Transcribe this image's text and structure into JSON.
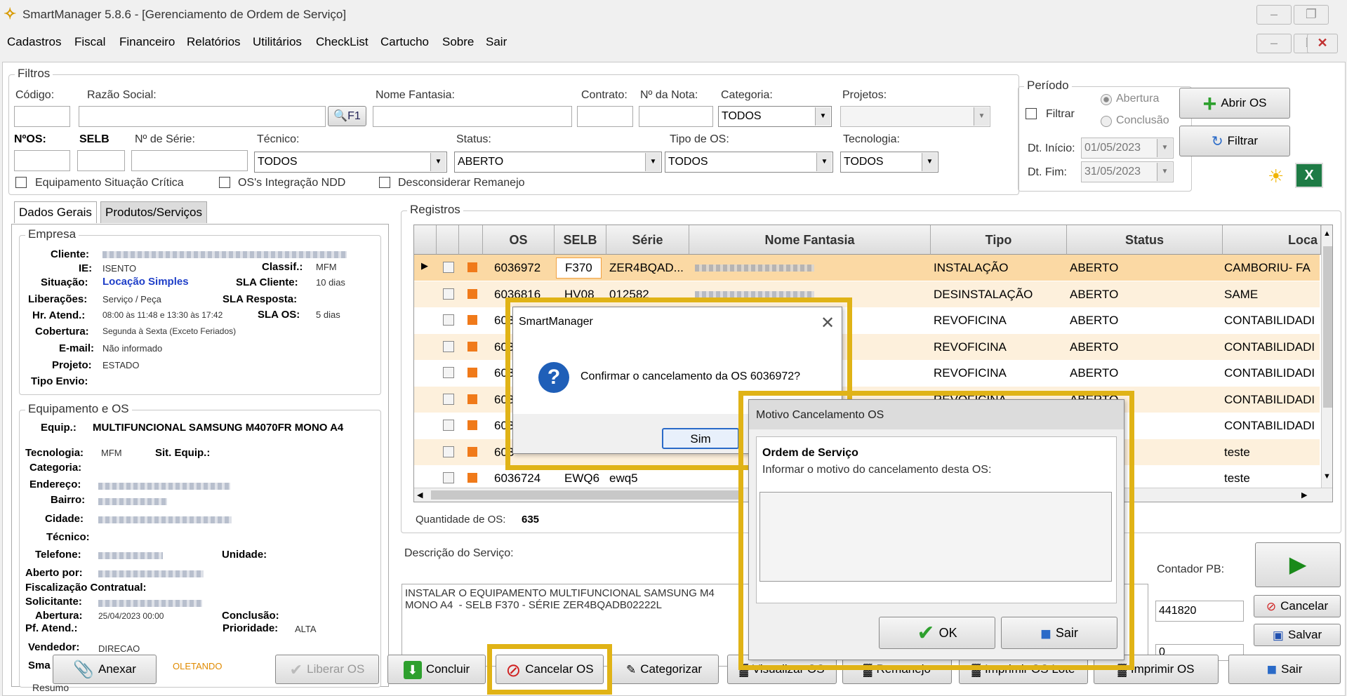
{
  "window": {
    "title": "SmartManager 5.8.6 - [Gerenciamento de Ordem de Serviço]"
  },
  "menu": [
    "Cadastros",
    "Fiscal",
    "Financeiro",
    "Relatórios",
    "Utilitários",
    "CheckList",
    "Cartucho",
    "Sobre",
    "Sair"
  ],
  "filters": {
    "group_label": "Filtros",
    "codigo_label": "Código:",
    "razao_label": "Razão Social:",
    "f1_button": "F1",
    "nome_fantasia_label": "Nome Fantasia:",
    "contrato_label": "Contrato:",
    "nota_label": "Nº da Nota:",
    "categoria_label": "Categoria:",
    "categoria_value": "TODOS",
    "projetos_label": "Projetos:",
    "nos_label": "NºOS:",
    "selb_label": "SELB",
    "serie_label": "Nº de Série:",
    "tecnico_label": "Técnico:",
    "tecnico_value": "TODOS",
    "status_label": "Status:",
    "status_value": "ABERTO",
    "tipo_os_label": "Tipo de OS:",
    "tipo_os_value": "TODOS",
    "tecnologia_label": "Tecnologia:",
    "tecnologia_value": "TODOS",
    "chk_critica": "Equipamento Situação Crítica",
    "chk_ndd": "OS's Integração NDD",
    "chk_remanejo": "Desconsiderar Remanejo"
  },
  "periodo": {
    "group_label": "Período",
    "filtrar_label": "Filtrar",
    "abertura": "Abertura",
    "conclusao": "Conclusão",
    "dt_inicio_label": "Dt. Início:",
    "dt_inicio": "01/05/2023",
    "dt_fim_label": "Dt. Fim:",
    "dt_fim": "31/05/2023"
  },
  "buttons": {
    "abrir_os": "Abrir OS",
    "filtrar": "Filtrar"
  },
  "tabs": [
    "Dados Gerais",
    "Produtos/Serviços"
  ],
  "empresa": {
    "group_label": "Empresa",
    "cliente_label": "Cliente:",
    "ie_label": "IE:",
    "ie": "ISENTO",
    "classif_label": "Classif.:",
    "classif": "MFM",
    "situacao_label": "Situação:",
    "situacao": "Locação Simples",
    "sla_cliente_label": "SLA Cliente:",
    "sla_cliente": "10 dias",
    "liberacoes_label": "Liberações:",
    "liberacoes": "Serviço / Peça",
    "sla_resposta_label": "SLA Resposta:",
    "hr_atend_label": "Hr. Atend.:",
    "hr_atend": "08:00 às 11:48 e 13:30 às 17:42",
    "sla_os_label": "SLA OS:",
    "sla_os": "5 dias",
    "cobertura_label": "Cobertura:",
    "cobertura": "Segunda à Sexta (Exceto Feriados)",
    "email_label": "E-mail:",
    "email": "Não informado",
    "projeto_label": "Projeto:",
    "projeto": "ESTADO",
    "tipo_envio_label": "Tipo Envio:"
  },
  "equipamento": {
    "group_label": "Equipamento e OS",
    "equip_label": "Equip.:",
    "equip": "MULTIFUNCIONAL SAMSUNG M4070FR MONO A4",
    "tecnologia_label": "Tecnologia:",
    "tecnologia": "MFM",
    "sit_equip_label": "Sit. Equip.:",
    "categoria_label": "Categoria:",
    "endereco_label": "Endereço:",
    "bairro_label": "Bairro:",
    "cidade_label": "Cidade:",
    "tecnico_label": "Técnico:",
    "telefone_label": "Telefone:",
    "unidade_label": "Unidade:",
    "aberto_por_label": "Aberto por:",
    "fiscalizacao_label": "Fiscalização Contratual:",
    "solicitante_label": "Solicitante:",
    "abertura_label": "Abertura:",
    "abertura": "25/04/2023 00:00",
    "conclusao_label": "Conclusão:",
    "pf_atend_label": "Pf. Atend.:",
    "prioridade_label": "Prioridade:",
    "prioridade": "ALTA",
    "vendedor_label": "Vendedor:",
    "vendedor": "DIRECAO",
    "sma_label": "Sma",
    "sma_value": "OLETANDO",
    "resumo_label": "Resumo"
  },
  "registros": {
    "group_label": "Registros",
    "columns": [
      "OS",
      "SELB",
      "Série",
      "Nome Fantasia",
      "Tipo",
      "Status",
      "Loca"
    ],
    "rows": [
      {
        "os": "6036972",
        "selb": "F370",
        "serie": "ZER4BQAD...",
        "tipo": "INSTALAÇÃO",
        "status": "ABERTO",
        "local": "CAMBORIU- FA"
      },
      {
        "os": "6036816",
        "selb": "HV08",
        "serie": "012582",
        "tipo": "DESINSTALAÇÃO",
        "status": "ABERTO",
        "local": "SAME"
      },
      {
        "os": "603",
        "selb": "",
        "serie": "",
        "tipo": "REVOFICINA",
        "status": "ABERTO",
        "local": "CONTABILIDADI"
      },
      {
        "os": "603",
        "selb": "",
        "serie": "",
        "tipo": "REVOFICINA",
        "status": "ABERTO",
        "local": "CONTABILIDADI"
      },
      {
        "os": "603",
        "selb": "",
        "serie": "",
        "tipo": "REVOFICINA",
        "status": "ABERTO",
        "local": "CONTABILIDADI"
      },
      {
        "os": "603",
        "selb": "",
        "serie": "",
        "tipo": "REVOFICINA",
        "status": "ABERTO",
        "local": "CONTABILIDADI"
      },
      {
        "os": "603",
        "selb": "",
        "serie": "",
        "tipo": "",
        "status": "",
        "local": "CONTABILIDADI"
      },
      {
        "os": "603",
        "selb": "",
        "serie": "",
        "tipo": "",
        "status": "",
        "local": "teste"
      },
      {
        "os": "6036724",
        "selb": "EWQ6",
        "serie": "ewq5",
        "tipo": "",
        "status": "",
        "local": "teste"
      }
    ],
    "qty_label": "Quantidade de OS:",
    "qty": "635"
  },
  "descricao": {
    "label": "Descrição do Serviço:",
    "text": "INSTALAR O EQUIPAMENTO MULTIFUNCIONAL SAMSUNG M4\nMONO A4  - SELB F370 - SÉRIE ZER4BQADB02222L"
  },
  "contador": {
    "label": "Contador PB:",
    "value": "441820",
    "value2": "0"
  },
  "side_buttons": {
    "cancelar": "Cancelar",
    "salvar": "Salvar"
  },
  "bottom_buttons": {
    "anexar": "Anexar",
    "liberar_os": "Liberar OS",
    "concluir": "Concluir",
    "cancelar_os": "Cancelar OS",
    "categorizar": "Categorizar",
    "visualizar_os": "Visualizar OS",
    "remanejo": "Remanejo",
    "imprimir_os_lote": "Imprimir OS Lote",
    "imprimir_os": "Imprimir OS",
    "sair": "Sair"
  },
  "confirm_dialog": {
    "title": "SmartManager",
    "message": "Confirmar o cancelamento da OS 6036972?",
    "sim": "Sim"
  },
  "motivo_dialog": {
    "title": "Motivo Cancelamento OS",
    "group": "Ordem de Serviço",
    "prompt": "Informar o motivo do cancelamento desta OS:",
    "ok": "OK",
    "sair": "Sair"
  },
  "colors": {
    "highlight": "#e0b316",
    "selected_row": "#fbd9a4",
    "alt_row": "#fdf0dc",
    "marker": "#f07a1a",
    "link_blue": "#1f3fc8"
  }
}
